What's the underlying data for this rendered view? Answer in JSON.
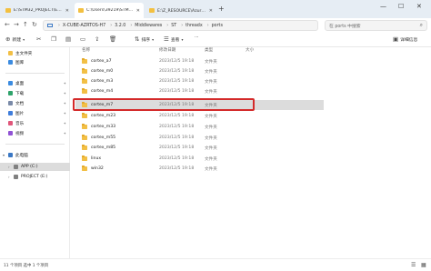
{
  "tabs": [
    {
      "label": "E:\\STM32_PROJECT\\Example\\7..."
    },
    {
      "label": "C:\\Users\\39219\\STM32Cube\\Re"
    },
    {
      "label": "E:\\Z_RESOURCE\\Azure\\环境搭建"
    }
  ],
  "window": {
    "minimize": "—",
    "maximize": "☐",
    "close": "✕"
  },
  "nav": {
    "back": "←",
    "forward": "→",
    "up": "↑",
    "refresh": "↻"
  },
  "address": {
    "crumbs": [
      "X-CUBE-AZRTOS-H7",
      "3.2.0",
      "Middlewares",
      "ST",
      "threadx",
      "ports"
    ],
    "separator": "›"
  },
  "search": {
    "placeholder": "在 ports 中搜索"
  },
  "toolbar": {
    "new_label": "新建",
    "sort_label": "排序",
    "view_label": "查看",
    "more_label": "···",
    "details_label": "详细信息"
  },
  "sidebar": {
    "items": [
      {
        "label": "主文件夹",
        "color": "#f2bf45"
      },
      {
        "label": "图库",
        "color": "#3b8be0"
      },
      {
        "label": "桌面",
        "color": "#3b8be0"
      },
      {
        "label": "下载",
        "color": "#2fa36b"
      },
      {
        "label": "文档",
        "color": "#7a8aa8"
      },
      {
        "label": "图片",
        "color": "#3f7ddb"
      },
      {
        "label": "音乐",
        "color": "#e0567a"
      },
      {
        "label": "视频",
        "color": "#9052d4"
      },
      {
        "label": "此电脑",
        "color": "#3b78c4"
      },
      {
        "label": "APP (C:)",
        "color": "#808080"
      },
      {
        "label": "PROJECT (E:)",
        "color": "#808080"
      }
    ]
  },
  "columns": {
    "name": "名称",
    "date": "修改日期",
    "type": "类型",
    "size": "大小"
  },
  "files": [
    {
      "name": "cortex_a7",
      "date": "2023/12/5 19:18",
      "type": "文件夹"
    },
    {
      "name": "cortex_m0",
      "date": "2023/12/5 19:18",
      "type": "文件夹"
    },
    {
      "name": "cortex_m3",
      "date": "2023/12/5 19:18",
      "type": "文件夹"
    },
    {
      "name": "cortex_m4",
      "date": "2023/12/5 19:18",
      "type": "文件夹"
    },
    {
      "name": "cortex_m7",
      "date": "2023/12/5 19:18",
      "type": "文件夹"
    },
    {
      "name": "cortex_m23",
      "date": "2023/12/5 19:18",
      "type": "文件夹"
    },
    {
      "name": "cortex_m33",
      "date": "2023/12/5 19:18",
      "type": "文件夹"
    },
    {
      "name": "cortex_m55",
      "date": "2023/12/5 19:18",
      "type": "文件夹"
    },
    {
      "name": "cortex_m85",
      "date": "2023/12/5 19:18",
      "type": "文件夹"
    },
    {
      "name": "linux",
      "date": "2023/12/5 19:18",
      "type": "文件夹"
    },
    {
      "name": "win32",
      "date": "2023/12/5 19:18",
      "type": "文件夹"
    }
  ],
  "status": {
    "text": "11 个项目    选中 1 个项目"
  },
  "colors": {
    "highlight": "#d42a2a",
    "selection": "#dcdcdc",
    "folder": "#f2bf45"
  }
}
